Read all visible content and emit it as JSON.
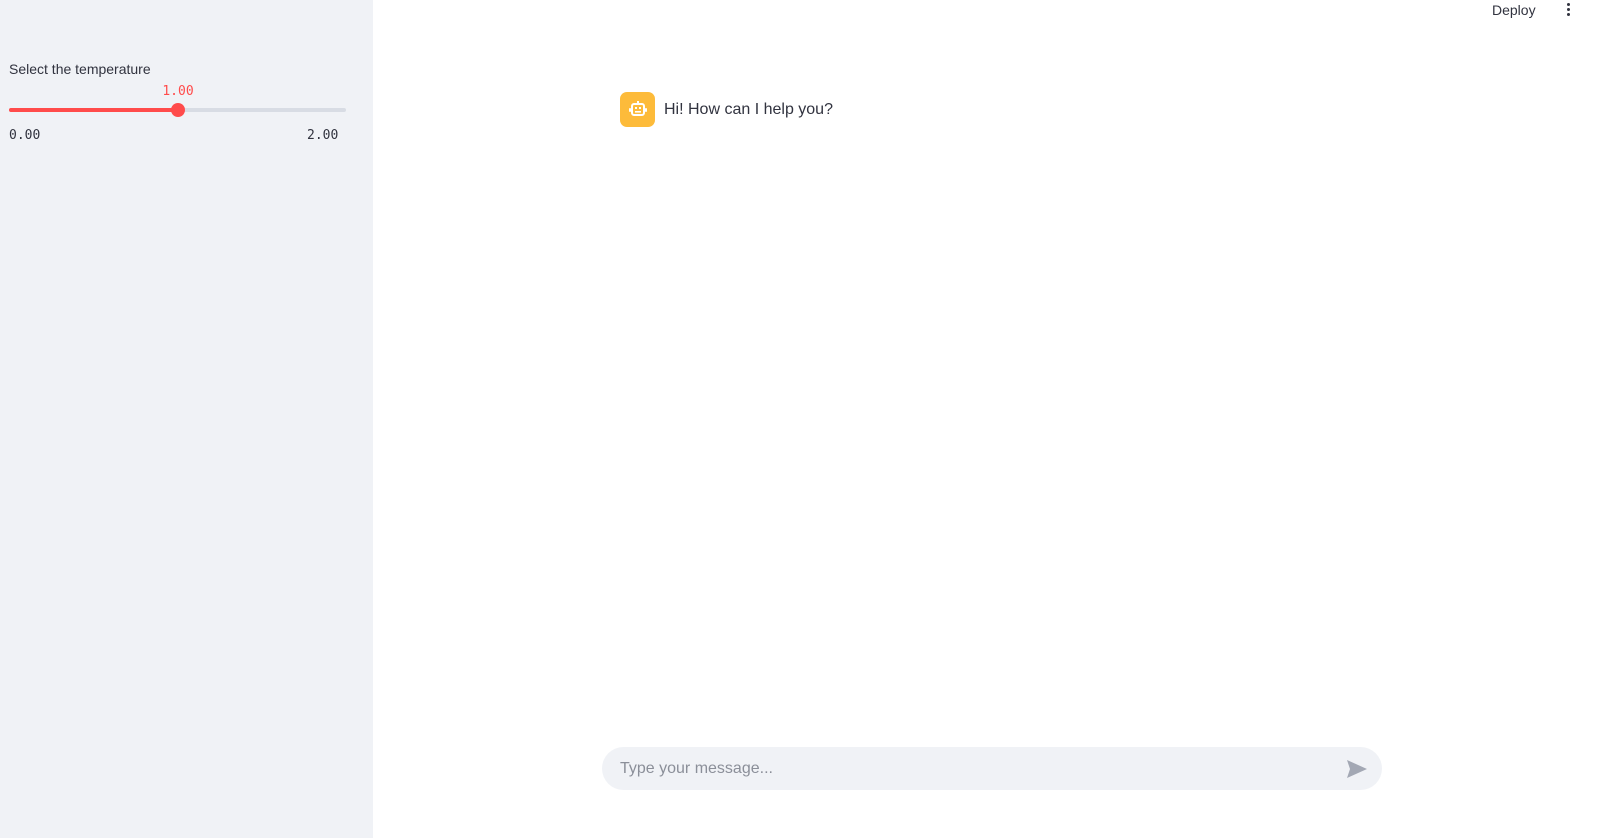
{
  "sidebar": {
    "slider": {
      "label": "Select the temperature",
      "value": "1.00",
      "min": "0.00",
      "max": "2.00",
      "fraction": 0.5
    }
  },
  "header": {
    "deploy_label": "Deploy",
    "menu_icon": "more-vertical-icon"
  },
  "chat": {
    "messages": [
      {
        "role": "assistant",
        "avatar_icon": "robot-icon",
        "text": "Hi! How can I help you?"
      }
    ],
    "input": {
      "placeholder": "Type your message...",
      "value": ""
    },
    "send_icon": "send-icon"
  },
  "colors": {
    "accent": "#ff4b4b",
    "sidebar_bg": "#f0f2f6",
    "avatar_bg": "#fdbb3a",
    "text": "#31333f"
  }
}
